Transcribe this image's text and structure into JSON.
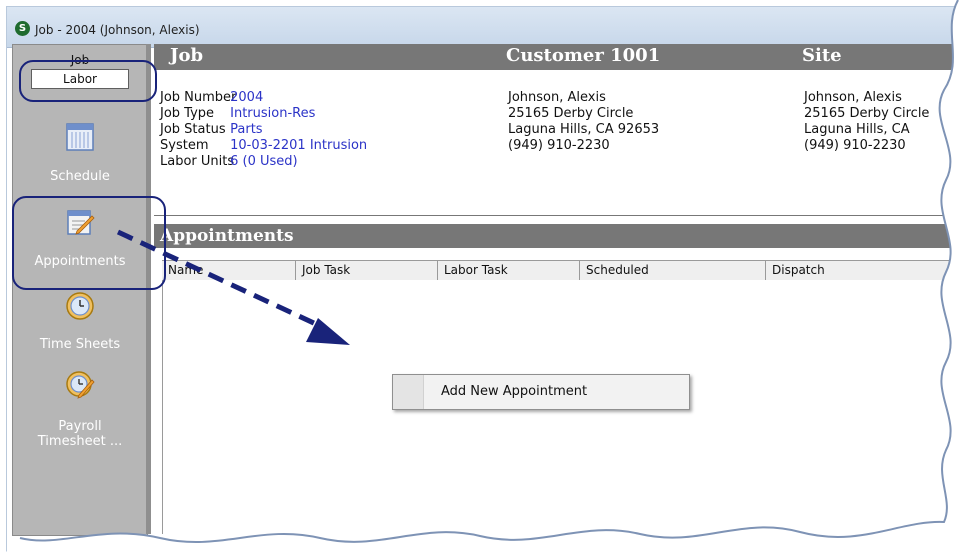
{
  "window": {
    "title": "Job - 2004 (Johnson, Alexis)",
    "app_icon_letter": "S"
  },
  "sidebar": {
    "section_title": "Job",
    "selected_label": "Labor",
    "items": [
      {
        "label": "Schedule",
        "icon": "calendar-icon"
      },
      {
        "label": "Appointments",
        "icon": "appointment-notepad-icon"
      },
      {
        "label": "Time Sheets",
        "icon": "clock-icon"
      },
      {
        "label_line1": "Payroll",
        "label_line2": "Timesheet ...",
        "icon": "payroll-timesheet-icon"
      }
    ]
  },
  "header": {
    "job_heading": "Job",
    "customer_heading": "Customer 1001",
    "site_heading": "Site"
  },
  "job": {
    "fields": [
      {
        "label": "Job Number",
        "value": "2004"
      },
      {
        "label": "Job Type",
        "value": "Intrusion-Res"
      },
      {
        "label": "Job Status",
        "value": "Parts"
      },
      {
        "label": "System",
        "value": "10-03-2201 Intrusion"
      },
      {
        "label": "Labor Units",
        "value": "6 (0 Used)"
      }
    ]
  },
  "customer": {
    "lines": [
      "Johnson, Alexis",
      "25165 Derby Circle",
      "Laguna Hills, CA  92653",
      "(949) 910-2230"
    ]
  },
  "site": {
    "lines": [
      "Johnson, Alexis",
      "25165 Derby Circle",
      "Laguna Hills, CA",
      "(949) 910-2230"
    ]
  },
  "appointments": {
    "title": "Appointments",
    "columns": [
      "Name",
      "Job Task",
      "Labor Task",
      "Scheduled",
      "Dispatch"
    ]
  },
  "context_menu": {
    "items": [
      "Add New Appointment"
    ]
  },
  "colors": {
    "header_bar": "#777777",
    "link_value": "#2b33c7",
    "callout": "#19237a",
    "sidebar": "#b6b6b6"
  }
}
